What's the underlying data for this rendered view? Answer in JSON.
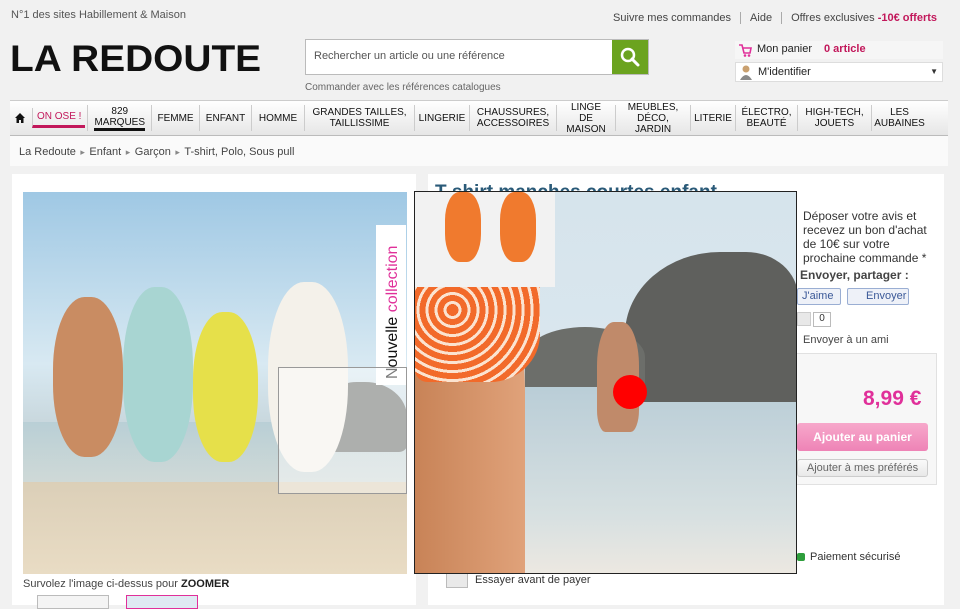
{
  "header": {
    "tagline": "N°1 des sites Habillement & Maison",
    "logo": "LA REDOUTE",
    "links": {
      "orders": "Suivre mes commandes",
      "help": "Aide",
      "offers_prefix": "Offres exclusives",
      "offers_highlight": "-10€ offerts"
    },
    "search": {
      "placeholder": "Rechercher un article ou une référence",
      "sub": "Commander avec les références catalogues"
    },
    "cart": {
      "label": "Mon panier",
      "count": "0 article"
    },
    "identify": {
      "label": "M'identifier"
    }
  },
  "nav": {
    "on_ose": "ON OSE !",
    "marques_count": "829",
    "marques": "MARQUES",
    "items": [
      "FEMME",
      "ENFANT",
      "HOMME",
      "GRANDES TAILLES, TAILLISSIME",
      "LINGERIE",
      "CHAUSSURES, ACCESSOIRES",
      "LINGE DE MAISON",
      "MEUBLES, DÉCO, JARDIN",
      "LITERIE",
      "ÉLECTRO, BEAUTÉ",
      "HIGH-TECH, JOUETS",
      "LES AUBAINES"
    ]
  },
  "breadcrumb": [
    "La Redoute",
    "Enfant",
    "Garçon",
    "T-shirt, Polo, Sous pull"
  ],
  "product": {
    "title": "T-shirt manches courtes enfant",
    "collection_word1": "Nouvelle",
    "collection_word2": "collection",
    "zoom_hint_prefix": "Survolez l'image ci-dessus pour",
    "zoom_hint_strong": "ZOOMER",
    "review": "Déposer votre avis et recevez un bon d'achat de 10€ sur votre prochaine commande *",
    "share_title": "Envoyer, partager :",
    "like": "J'aime",
    "send": "Envoyer",
    "plus_count": "0",
    "send_friend": "Envoyer à un ami",
    "price": "8,99 €",
    "add_cart": "Ajouter au panier",
    "add_fav": "Ajouter à mes préférés",
    "secure_payment": "Paiement sécurisé",
    "try_before": "Essayer avant de payer"
  },
  "colors": {
    "brand_pink": "#e0309a",
    "search_green": "#6ba31f",
    "title_blue": "#2a5a78"
  }
}
